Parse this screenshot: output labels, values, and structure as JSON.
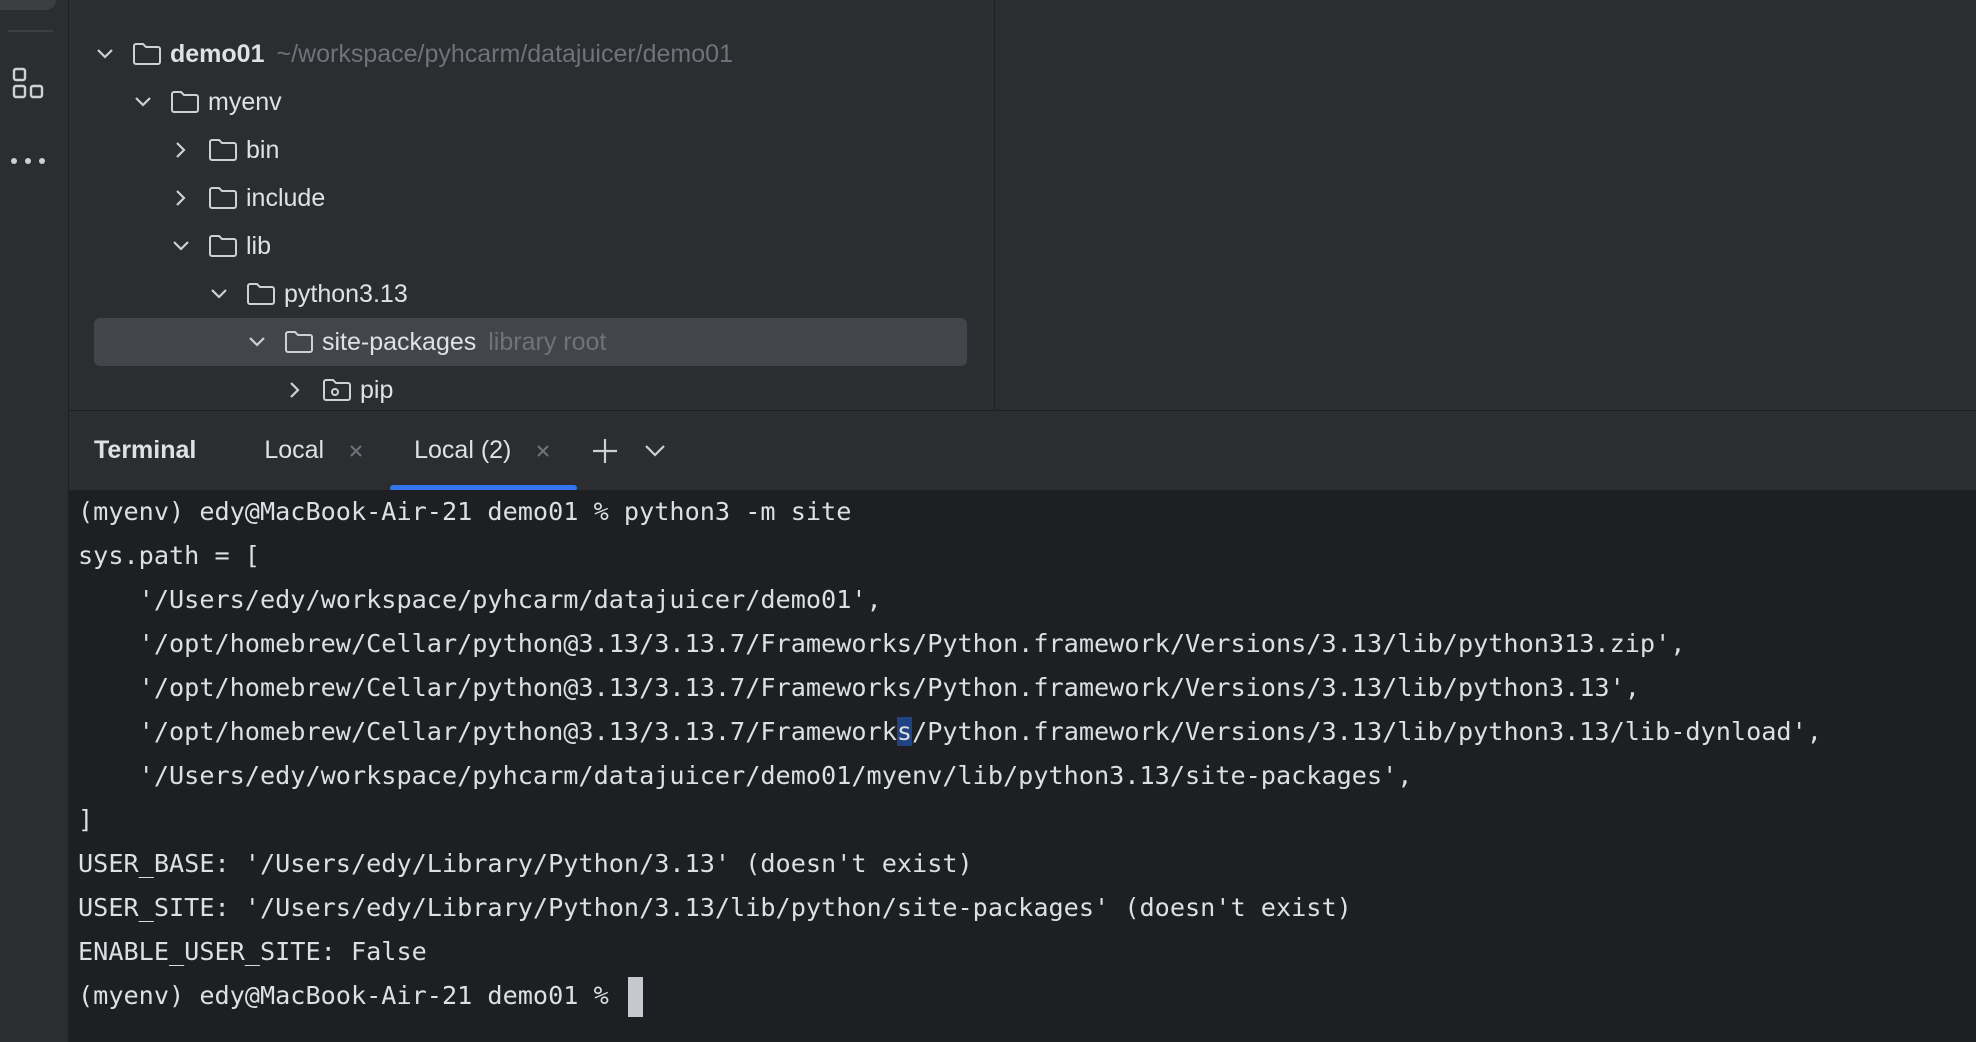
{
  "project_tree": {
    "items": [
      {
        "name": "demo01",
        "hint": "~/workspace/pyhcarm/datajuicer/demo01",
        "expanded": true,
        "depth": 0,
        "bold": true,
        "icon": "folder-icon"
      },
      {
        "name": "myenv",
        "hint": "",
        "expanded": true,
        "depth": 1,
        "icon": "folder-icon"
      },
      {
        "name": "bin",
        "hint": "",
        "expanded": false,
        "depth": 2,
        "icon": "folder-icon"
      },
      {
        "name": "include",
        "hint": "",
        "expanded": false,
        "depth": 2,
        "icon": "folder-icon"
      },
      {
        "name": "lib",
        "hint": "",
        "expanded": true,
        "depth": 2,
        "icon": "folder-icon"
      },
      {
        "name": "python3.13",
        "hint": "",
        "expanded": true,
        "depth": 3,
        "icon": "folder-icon"
      },
      {
        "name": "site-packages",
        "hint": "library root",
        "expanded": true,
        "depth": 4,
        "selected": true,
        "icon": "folder-icon"
      },
      {
        "name": "pip",
        "hint": "",
        "expanded": false,
        "depth": 5,
        "icon": "package-folder-icon"
      }
    ]
  },
  "terminal": {
    "title": "Terminal",
    "tabs": [
      {
        "label": "Local",
        "active": false
      },
      {
        "label": "Local (2)",
        "active": true
      }
    ],
    "lines": [
      "(myenv) edy@MacBook-Air-21 demo01 % python3 -m site",
      "sys.path = [",
      "    '/Users/edy/workspace/pyhcarm/datajuicer/demo01',",
      "    '/opt/homebrew/Cellar/python@3.13/3.13.7/Frameworks/Python.framework/Versions/3.13/lib/python313.zip',",
      "    '/opt/homebrew/Cellar/python@3.13/3.13.7/Frameworks/Python.framework/Versions/3.13/lib/python3.13',",
      "    '/opt/homebrew/Cellar/python@3.13/3.13.7/Framework",
      "s",
      "/Python.framework/Versions/3.13/lib/python3.13/lib-dynload',",
      "    '/Users/edy/workspace/pyhcarm/datajuicer/demo01/myenv/lib/python3.13/site-packages',",
      "]",
      "USER_BASE: '/Users/edy/Library/Python/3.13' (doesn't exist)",
      "USER_SITE: '/Users/edy/Library/Python/3.13/lib/python/site-packages' (doesn't exist)",
      "ENABLE_USER_SITE: False",
      "(myenv) edy@MacBook-Air-21 demo01 % "
    ]
  },
  "colors": {
    "accent": "#3574f0",
    "panel_bg": "#2b2d30",
    "terminal_bg": "#1e1f22",
    "selection_bg": "#43454a"
  }
}
